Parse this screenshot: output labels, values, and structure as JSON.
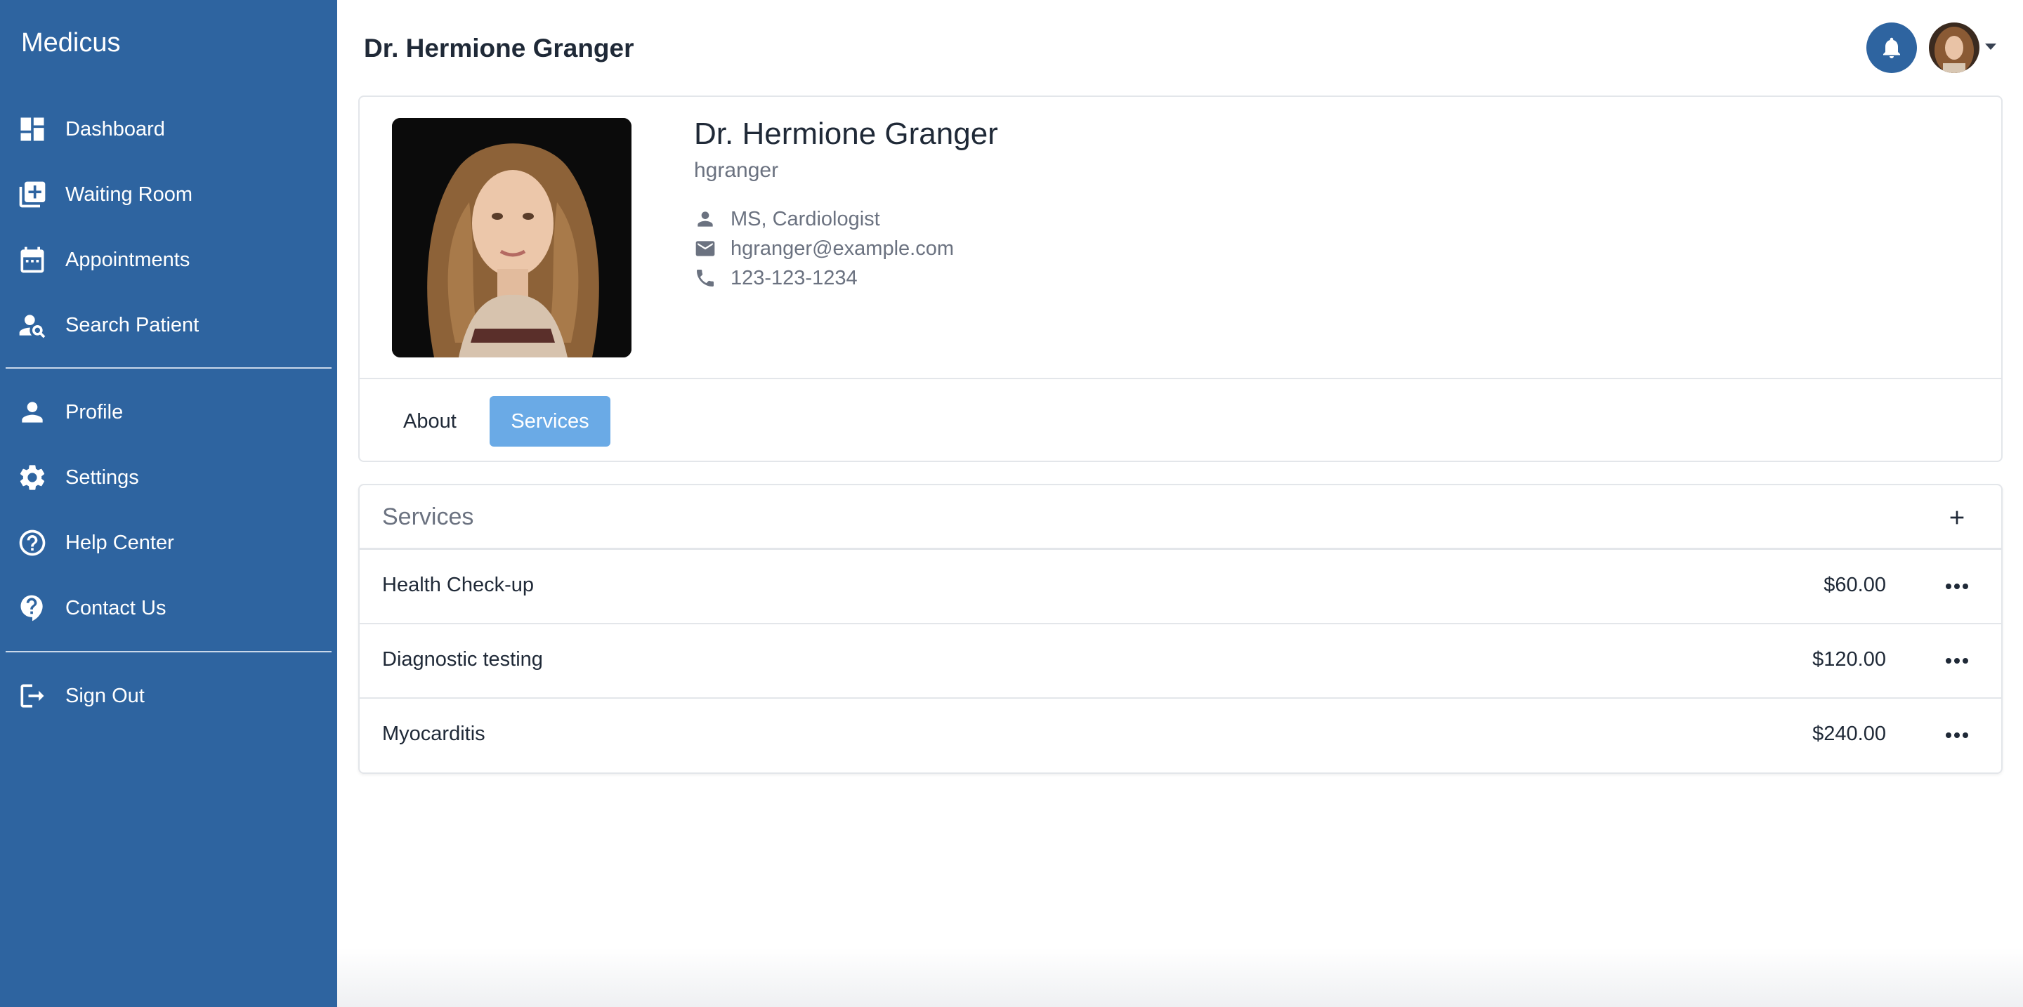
{
  "sidebar": {
    "brand": "Medicus",
    "items": [
      {
        "label": "Dashboard",
        "icon": "dashboard-icon"
      },
      {
        "label": "Waiting Room",
        "icon": "add-box-icon"
      },
      {
        "label": "Appointments",
        "icon": "calendar-icon"
      },
      {
        "label": "Search Patient",
        "icon": "person-search-icon"
      },
      {
        "label": "Profile",
        "icon": "person-icon"
      },
      {
        "label": "Settings",
        "icon": "gear-icon"
      },
      {
        "label": "Help Center",
        "icon": "help-circle-icon"
      },
      {
        "label": "Contact Us",
        "icon": "help-bubble-icon"
      },
      {
        "label": "Sign Out",
        "icon": "logout-icon"
      }
    ]
  },
  "header": {
    "title": "Dr. Hermione Granger"
  },
  "profile": {
    "name": "Dr. Hermione Granger",
    "username": "hgranger",
    "credentials": "MS, Cardiologist",
    "email": "hgranger@example.com",
    "phone": "123-123-1234",
    "tabs": [
      {
        "label": "About",
        "active": false
      },
      {
        "label": "Services",
        "active": true
      }
    ]
  },
  "services": {
    "title": "Services",
    "rows": [
      {
        "name": "Health Check-up",
        "price": "$60.00"
      },
      {
        "name": "Diagnostic testing",
        "price": "$120.00"
      },
      {
        "name": "Myocarditis",
        "price": "$240.00"
      }
    ]
  },
  "colors": {
    "sidebar": "#2e64a0",
    "active_tab": "#6aaae6",
    "border": "#e3e6ea"
  }
}
